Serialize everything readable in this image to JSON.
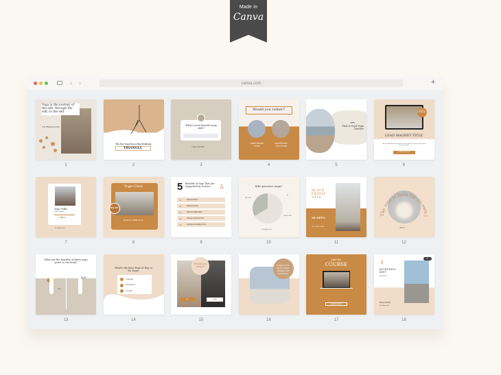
{
  "badge": {
    "made": "Made in",
    "brand": "Canva"
  },
  "browser": {
    "url": "canva.com",
    "back": "‹",
    "forward": "›",
    "new_tab": "+"
  },
  "colors": {
    "accent": "#c98a45",
    "beige": "#efdcc8",
    "stone": "#d8d0c4",
    "bg": "#fbf8f4"
  },
  "templates": [
    {
      "num": "1",
      "quote": "Yoga is the journey of the self, through the self, to the self.",
      "author": "The Bhagavad Gita"
    },
    {
      "num": "2",
      "subtitle": "The One Yoga Pose a Day Challenge",
      "title": "TRIANGLE"
    },
    {
      "num": "3",
      "question": "What's your favorite yoga style?",
      "signature": "Yoga Lifestyle"
    },
    {
      "num": "4",
      "title": "Would you rather?",
      "option_a": "DEEP BENDS POSE",
      "option_b": "HANDSTAND YOGA POSE"
    },
    {
      "num": "5",
      "kicker": "TIPS",
      "title": "Find A Good Yoga Teacher"
    },
    {
      "num": "6",
      "badge": "FREE TO DOWNLOAD",
      "title": "LEAD MAGNET TITLE",
      "body": "We love beginners and welcome them to all of our classes. If you want to start out more",
      "button": "DOWNLOAD NOW"
    },
    {
      "num": "7",
      "track": "Yoga Talks",
      "artist": "Podcast Episode",
      "handle": "@reallygreatsite"
    },
    {
      "num": "8",
      "title": "Yoga Class",
      "badge": "30% OFF",
      "footer": "Jan 20-22 | 7.30PM | At Ines"
    },
    {
      "num": "9",
      "big": "5",
      "title": "Benefits of Yoga That Are Supported by Science",
      "items": [
        {
          "n": "01",
          "t": "Reduces Stress"
        },
        {
          "n": "02",
          "t": "Relieves Anxiety"
        },
        {
          "n": "03",
          "t": "Reduces Inflammation"
        },
        {
          "n": "04",
          "t": "Improves Heart Function"
        },
        {
          "n": "05",
          "t": "Improves the Quality of Life"
        }
      ]
    },
    {
      "num": "10",
      "title": "Who practice yoga?",
      "label_a": "Men 36%",
      "label_b": "Women 64%",
      "handle": "@reallygreatsite"
    },
    {
      "num": "11",
      "title": "BLACK FRIDAY SALE",
      "discount": "30 OFF%",
      "footer": "ON YOGA COURSE"
    },
    {
      "num": "12",
      "arc": "The soul is here for its own joy",
      "sign": "Rumi"
    },
    {
      "num": "13",
      "title": "What are the benefits of these yoga poses to the body?",
      "pose_a": "Chair",
      "pose_b": "Shoulder Stand"
    },
    {
      "num": "14",
      "title": "What's the Best Time of Day to Do Yoga?",
      "options": [
        "MORNING",
        "AFTERNOON",
        "EVENING"
      ]
    },
    {
      "num": "15",
      "title": "Would you rather?",
      "option_a": "JOY",
      "option_b": "MORE"
    },
    {
      "num": "16",
      "title": "Support Your Body's Inner Wisdom And Limitations"
    },
    {
      "num": "17",
      "kicker": "Join The",
      "title": "COURSE",
      "button": "REGISTER NOW"
    },
    {
      "num": "18",
      "title": "AYURVEDIC DIET",
      "sub": "EPISODE 15",
      "sign": "Jenny Smith",
      "handle": "@reallygreatsite",
      "more": "•••"
    }
  ]
}
